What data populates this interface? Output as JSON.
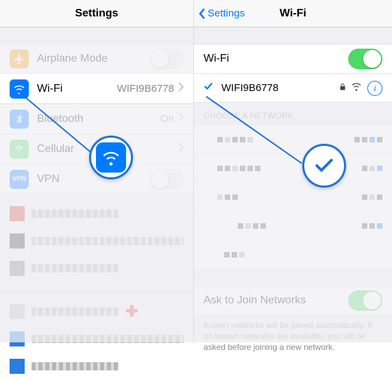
{
  "left": {
    "title": "Settings",
    "rows": {
      "airplane": {
        "label": "Airplane Mode"
      },
      "wifi": {
        "label": "Wi-Fi",
        "value": "WIFI9B6778"
      },
      "bluetooth": {
        "label": "Bluetooth",
        "value": "On"
      },
      "cellular": {
        "label": "Cellular"
      },
      "vpn": {
        "label": "VPN",
        "badge": "VPN"
      }
    }
  },
  "right": {
    "back": "Settings",
    "title": "Wi-Fi",
    "switch_label": "Wi-Fi",
    "connected_ssid": "WIFI9B6778",
    "section_choose": "CHOOSE A NETWORK...",
    "ask_label": "Ask to Join Networks",
    "ask_footnote": "Known networks will be joined automatically. If no known networks are available, you will be asked before joining a new network."
  },
  "colors": {
    "link": "#007aff",
    "toggle_on": "#4cd964"
  }
}
